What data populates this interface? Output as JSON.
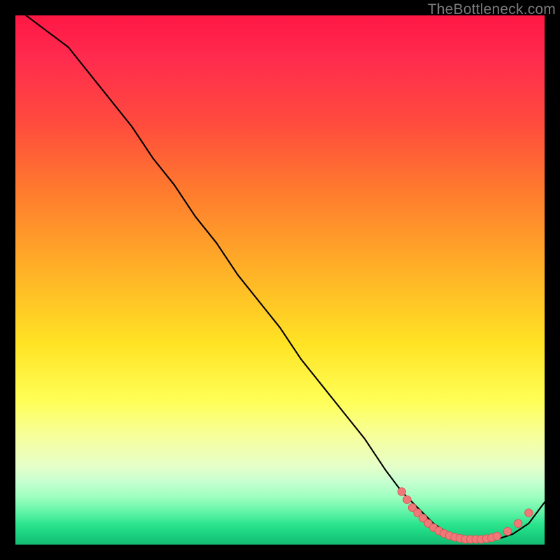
{
  "watermark": {
    "text": "TheBottleneck.com"
  },
  "colors": {
    "curve": "#000000",
    "marker_fill": "#f07878",
    "marker_stroke": "#d85a5a",
    "background": "#000000"
  },
  "chart_data": {
    "type": "line",
    "title": "",
    "xlabel": "",
    "ylabel": "",
    "xlim": [
      0,
      100
    ],
    "ylim": [
      0,
      100
    ],
    "grid": false,
    "legend": false,
    "note": "Axes unlabeled in source; values estimated as percentage of plot width/height from gridless heatmap-style background.",
    "series": [
      {
        "name": "curve",
        "x": [
          2,
          6,
          10,
          14,
          18,
          22,
          26,
          30,
          34,
          38,
          42,
          46,
          50,
          54,
          58,
          62,
          66,
          70,
          73,
          76,
          79,
          82,
          85,
          88,
          91,
          94,
          97,
          100
        ],
        "y": [
          100,
          97,
          94,
          89,
          84,
          79,
          73,
          68,
          62,
          57,
          51,
          46,
          41,
          35,
          30,
          25,
          20,
          14,
          10,
          7,
          4,
          2,
          1,
          1,
          1,
          2,
          4,
          8
        ]
      }
    ],
    "markers": [
      {
        "x": 73,
        "y": 10
      },
      {
        "x": 74,
        "y": 8.5
      },
      {
        "x": 75,
        "y": 7
      },
      {
        "x": 76,
        "y": 6
      },
      {
        "x": 77,
        "y": 5
      },
      {
        "x": 78,
        "y": 4
      },
      {
        "x": 79,
        "y": 3.2
      },
      {
        "x": 80,
        "y": 2.6
      },
      {
        "x": 81,
        "y": 2.1
      },
      {
        "x": 82,
        "y": 1.7
      },
      {
        "x": 83,
        "y": 1.4
      },
      {
        "x": 84,
        "y": 1.2
      },
      {
        "x": 85,
        "y": 1.0
      },
      {
        "x": 86,
        "y": 1.0
      },
      {
        "x": 87,
        "y": 1.0
      },
      {
        "x": 88,
        "y": 1.0
      },
      {
        "x": 89,
        "y": 1.1
      },
      {
        "x": 90,
        "y": 1.3
      },
      {
        "x": 91,
        "y": 1.6
      },
      {
        "x": 93,
        "y": 2.5
      },
      {
        "x": 95,
        "y": 4.0
      },
      {
        "x": 97,
        "y": 6.0
      }
    ]
  }
}
